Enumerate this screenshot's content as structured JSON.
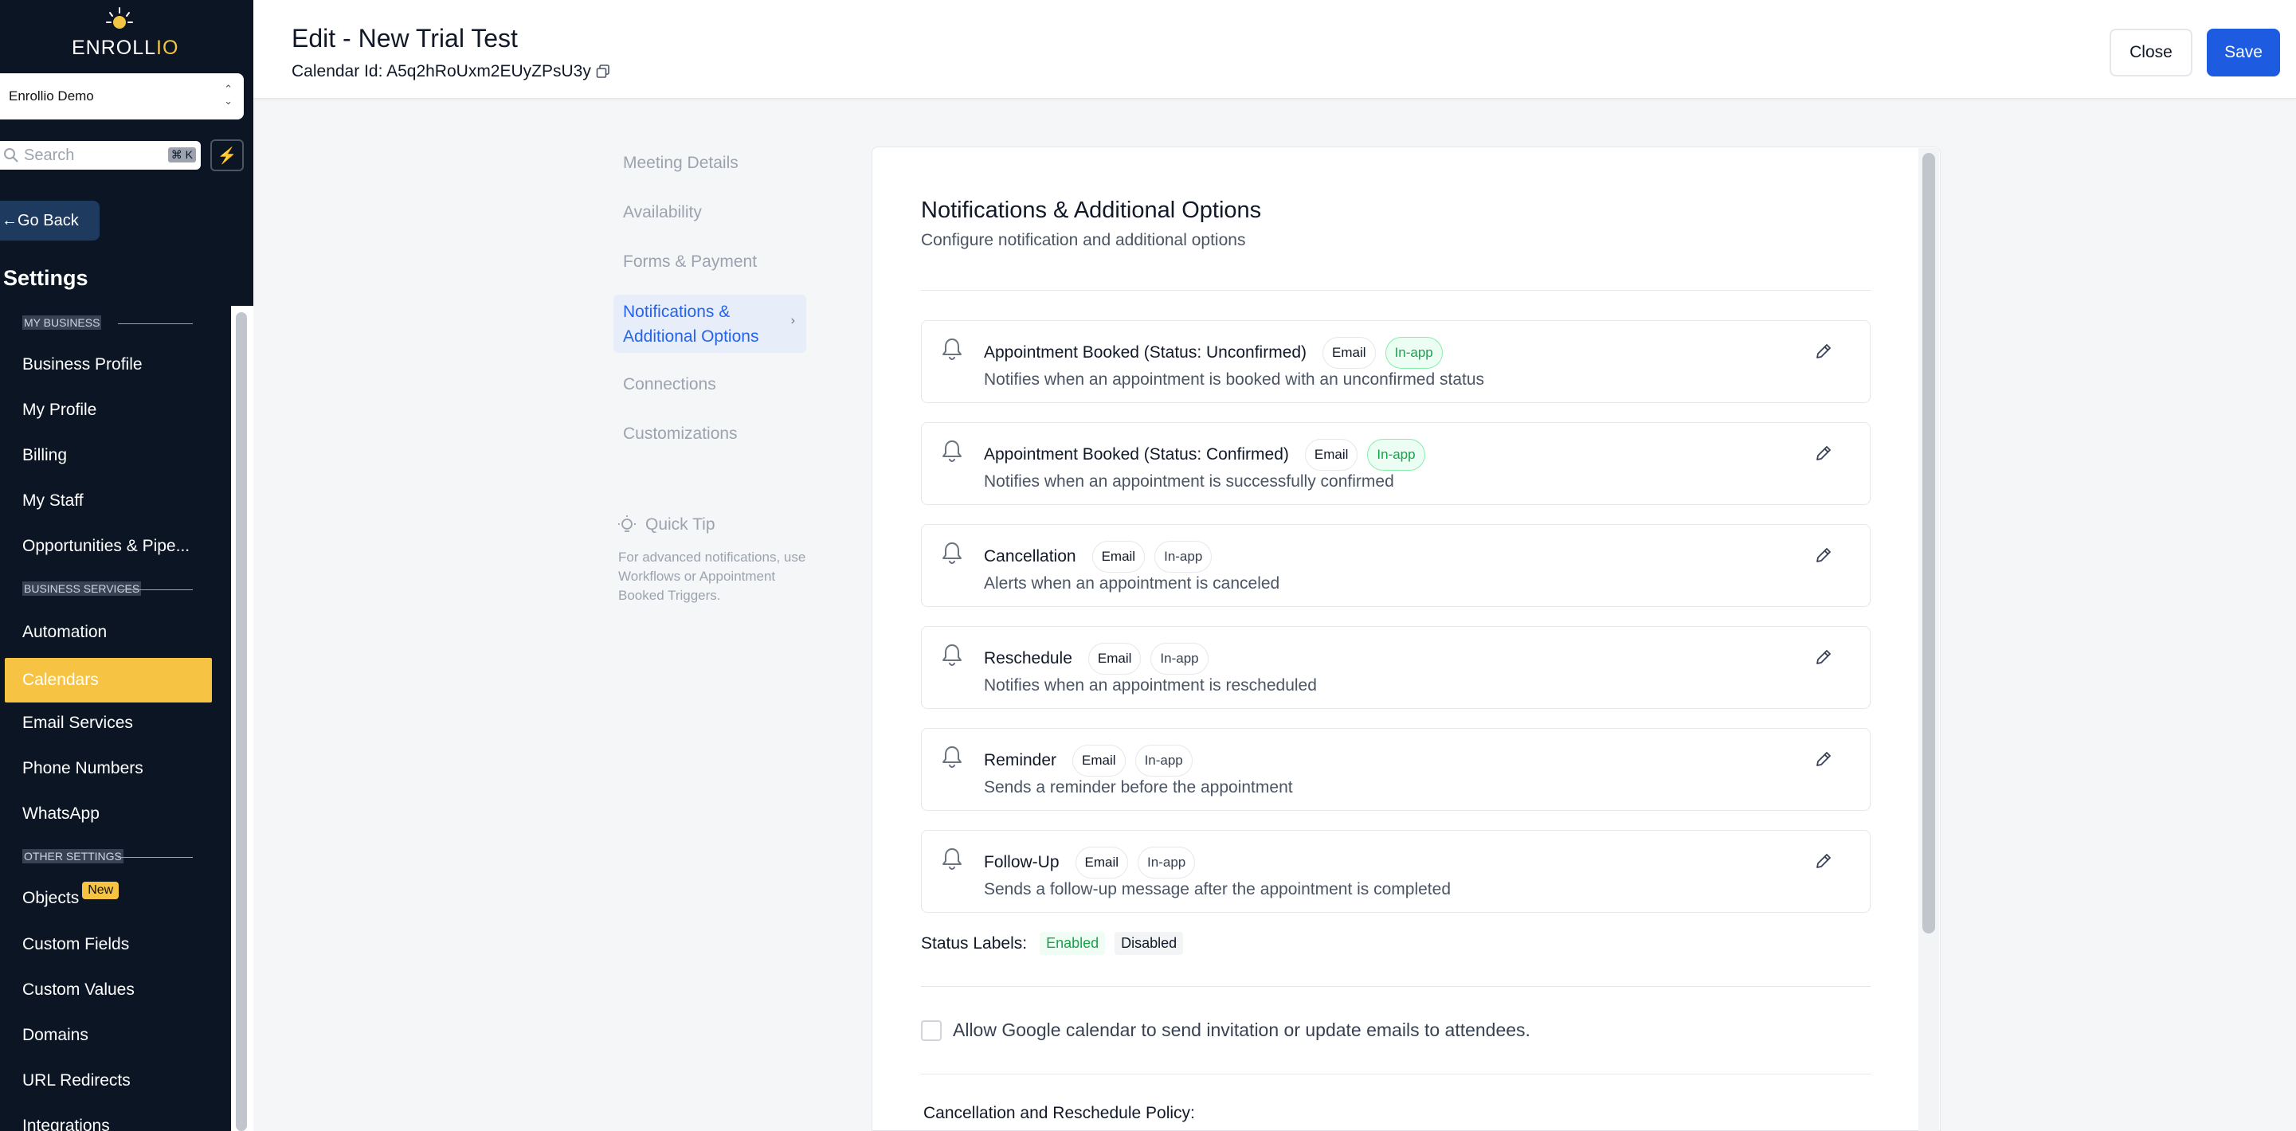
{
  "sidebar": {
    "logo_text_main": "ENROLL",
    "logo_text_accent": "IO",
    "account_name": "Enrollio Demo",
    "search_placeholder": "Search",
    "search_shortcut": "⌘ K",
    "go_back": "Go Back",
    "settings_title": "Settings",
    "sections": {
      "my_business": "MY BUSINESS",
      "business_services": "BUSINESS SERVICES",
      "other_settings": "OTHER SETTINGS"
    },
    "items": {
      "business_profile": "Business Profile",
      "my_profile": "My Profile",
      "billing": "Billing",
      "my_staff": "My Staff",
      "opportunities": "Opportunities & Pipe...",
      "automation": "Automation",
      "calendars": "Calendars",
      "email_services": "Email Services",
      "phone_numbers": "Phone Numbers",
      "whatsapp": "WhatsApp",
      "objects": "Objects",
      "objects_badge": "New",
      "custom_fields": "Custom Fields",
      "custom_values": "Custom Values",
      "domains": "Domains",
      "url_redirects": "URL Redirects",
      "integrations": "Integrations"
    },
    "active_item": "Calendars",
    "accent_color": "#f6c343"
  },
  "header": {
    "title": "Edit - New Trial Test",
    "calendar_id_label": "Calendar Id: A5q2hRoUxm2EUyZPsU3y",
    "close_label": "Close",
    "save_label": "Save",
    "save_color": "#1d5be0"
  },
  "subnav": {
    "items": {
      "meeting_details": "Meeting Details",
      "availability": "Availability",
      "forms_payment": "Forms & Payment",
      "notifications": "Notifications & Additional Options",
      "connections": "Connections",
      "customizations": "Customizations"
    },
    "active": "Notifications & Additional Options",
    "quick_tip_title": "Quick Tip",
    "quick_tip_body": "For advanced notifications, use Workflows or Appointment Booked Triggers."
  },
  "main": {
    "title": "Notifications & Additional Options",
    "subtitle": "Configure notification and additional options",
    "notifications": [
      {
        "name": "Appointment Booked (Status: Unconfirmed)",
        "email": "Email",
        "inapp": "In-app",
        "inapp_enabled": true,
        "desc": "Notifies when an appointment is booked with an unconfirmed status"
      },
      {
        "name": "Appointment Booked (Status: Confirmed)",
        "email": "Email",
        "inapp": "In-app",
        "inapp_enabled": true,
        "desc": "Notifies when an appointment is successfully confirmed"
      },
      {
        "name": "Cancellation",
        "email": "Email",
        "inapp": "In-app",
        "inapp_enabled": false,
        "desc": "Alerts when an appointment is canceled"
      },
      {
        "name": "Reschedule",
        "email": "Email",
        "inapp": "In-app",
        "inapp_enabled": false,
        "desc": "Notifies when an appointment is rescheduled"
      },
      {
        "name": "Reminder",
        "email": "Email",
        "inapp": "In-app",
        "inapp_enabled": false,
        "desc": "Sends a reminder before the appointment"
      },
      {
        "name": "Follow-Up",
        "email": "Email",
        "inapp": "In-app",
        "inapp_enabled": false,
        "desc": "Sends a follow-up message after the appointment is completed"
      }
    ],
    "status_labels_title": "Status Labels:",
    "status_enabled": "Enabled",
    "status_disabled": "Disabled",
    "google_calendar_option": "Allow Google calendar to send invitation or update emails to attendees.",
    "google_calendar_checked": false,
    "policy_title": "Cancellation and Reschedule Policy:"
  }
}
